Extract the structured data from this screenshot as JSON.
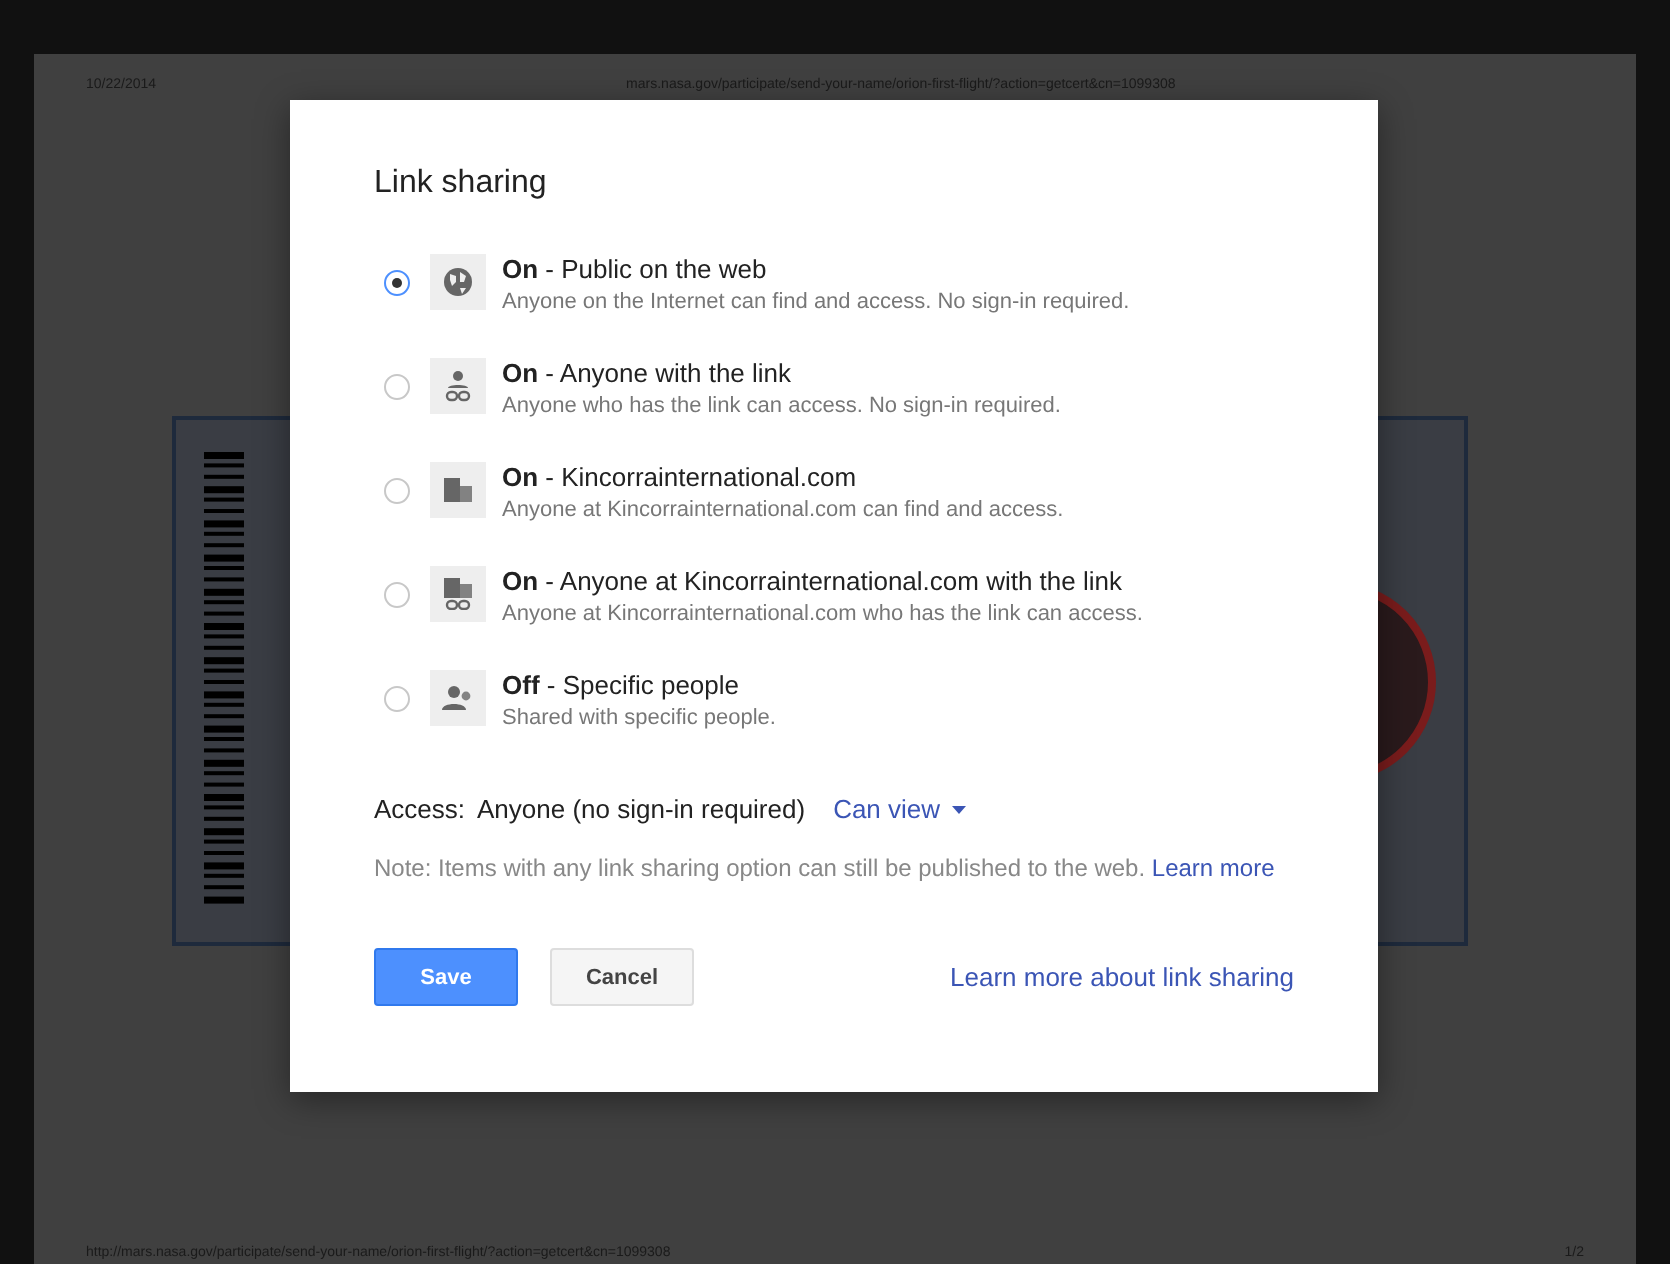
{
  "document": {
    "date": "10/22/2014",
    "url": "mars.nasa.gov/participate/send-your-name/orion-first-flight/?action=getcert&cn=1099308",
    "footer_url": "http://mars.nasa.gov/participate/send-your-name/orion-first-flight/?action=getcert&cn=1099308",
    "page": "1/2"
  },
  "dialog": {
    "title": "Link sharing",
    "options": [
      {
        "kind": "globe",
        "title": "**On** - Public on the web",
        "description": "Anyone on the Internet can find and access. No sign-in required.",
        "selected": true
      },
      {
        "kind": "person-link",
        "title": "**On** - Anyone with the link",
        "description": "Anyone who has the link can access. No sign-in required.",
        "selected": false
      },
      {
        "kind": "building",
        "title": "**On** - Kincorrainternational.com",
        "description": "Anyone at Kincorrainternational.com can find and access.",
        "selected": false
      },
      {
        "kind": "building-link",
        "title": "**On** - Anyone at Kincorrainternational.com with the link",
        "description": "Anyone at Kincorrainternational.com who has the link can access.",
        "selected": false
      },
      {
        "kind": "people",
        "title": "**Off** - Specific people",
        "description": "Shared with specific people.",
        "selected": false
      }
    ],
    "access": {
      "label": "Access:",
      "value": "Anyone (no sign-in required)",
      "permission": "Can view"
    },
    "note": "Note: Items with any link sharing option can still be published to the web.",
    "note_link": "Learn more",
    "save": "Save",
    "cancel": "Cancel",
    "help_link": "Learn more about link sharing"
  }
}
